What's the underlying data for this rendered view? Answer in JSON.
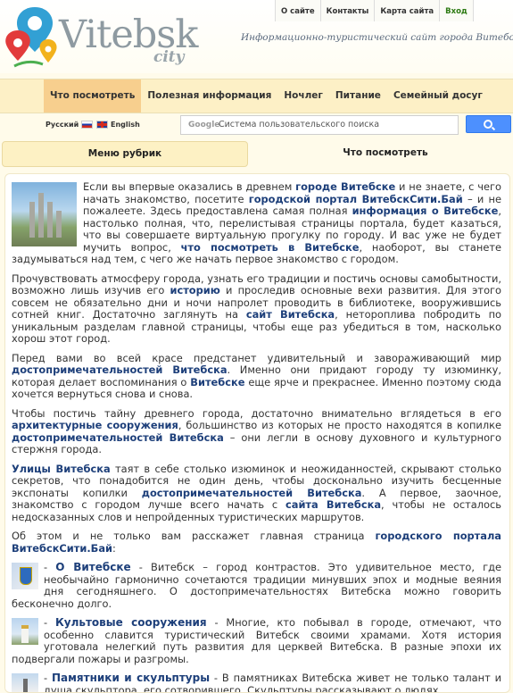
{
  "brand": {
    "name": "Vitebsk",
    "sub": "city",
    "slogan": "Информационно-туристический сайт города Витебска"
  },
  "top_nav": [
    "О сайте",
    "Контакты",
    "Карта сайта"
  ],
  "login": "Вход",
  "main_nav": [
    {
      "label": "Что посмотреть",
      "active": true
    },
    {
      "label": "Полезная информация",
      "active": false
    },
    {
      "label": "Ночлег",
      "active": false
    },
    {
      "label": "Питание",
      "active": false
    },
    {
      "label": "Семейный досуг",
      "active": false
    }
  ],
  "languages": {
    "ru": "Русский",
    "en": "English"
  },
  "search": {
    "brand": "Google",
    "placeholder": "Система пользовательского поиска"
  },
  "tabs": {
    "left": "Меню рубрик",
    "right": "Что посмотреть"
  },
  "article": {
    "p1": [
      "Если вы впервые оказались в древнем ",
      "городе Витебске",
      " и не знаете, с чего начать знакомство, посетите ",
      "городской портал ВитебскСити.Бай",
      " – и не пожалеете. Здесь предоставлена самая полная ",
      "информация о Витебске",
      ", настолько полная, что, перелистывая страницы портала, будет казаться, что вы совершаете виртуальную прогулку по городу. И вас уже не будет мучить вопрос, ",
      "что посмотреть в Витебске",
      ", наоборот, вы станете задумываться над тем, с чего же начать первое знакомство с городом."
    ],
    "p2": [
      "Прочувствовать атмосферу города, узнать его традиции и постичь основы самобытности, возможно лишь изучив его ",
      "историю",
      " и проследив основные вехи развития. Для этого совсем не обязательно дни и ночи напролет проводить в библиотеке, вооружившись сотней книг. Достаточно заглянуть на ",
      "сайт Витебска",
      ", нетороплива побродить по уникальным разделам главной страницы, чтобы еще раз убедиться в том, насколько хорош этот город."
    ],
    "p3": [
      "Перед вами во всей красе предстанет удивительный и завораживающий мир ",
      "достопримечательностей Витебска",
      ". Именно они придают городу ту изюминку, которая делает воспоминания о ",
      "Витебске",
      " еще ярче и прекраснее. Именно поэтому сюда хочется вернуться снова и снова."
    ],
    "p4": [
      "Чтобы постичь тайну древнего города, достаточно внимательно вглядеться в его ",
      "архитектурные сооружения",
      ", большинство из которых не просто находятся в копилке ",
      "достопримечательностей Витебска",
      " – они легли в основу духовного и культурного стержня города."
    ],
    "p5": [
      "Улицы Витебска",
      " таят в себе столько изюминок и неожиданностей, скрывают столько секретов, что понадобится не один день, чтобы досконально изучить бесценные экспонаты копилки ",
      "достопримечательностей Витебска",
      ". А первое, заочное, знакомство с городом лучше всего начать с ",
      "сайта Витебска",
      ", чтобы не осталось недосказанных слов и непройденных туристических маршрутов."
    ],
    "p6": [
      "Об этом и не только вам расскажет главная страница ",
      "городского портала ВитебскСити.Бай",
      ":"
    ],
    "items": [
      {
        "title": "О Витебске",
        "text": " - Витебск – город контрастов. Это удивительное место, где необычайно гармонично сочетаются традиции минувших эпох и модные веяния дня сегодняшнего. О достопримечательностях Витебска можно говорить бесконечно долго."
      },
      {
        "title": "Культовые сооружения",
        "text": " - Многие, кто побывал в городе, отмечают, что особенно славится туристический Витебск своими храмами. Хотя история уготовала нелегкий путь развития для церквей Витебска. В разные эпохи их подвергали пожары и разгромы."
      },
      {
        "title": "Памятники и скульптуры",
        "text": " - В памятниках Витебска живет не только талант и душа скульптора, его сотворившего. Скульптуры рассказывают о людях,"
      }
    ]
  },
  "colors": {
    "accent": "#f7cf8e",
    "nav_bg": "#fdf0c6",
    "link": "#1d3f7a",
    "login": "#2c7a12"
  }
}
